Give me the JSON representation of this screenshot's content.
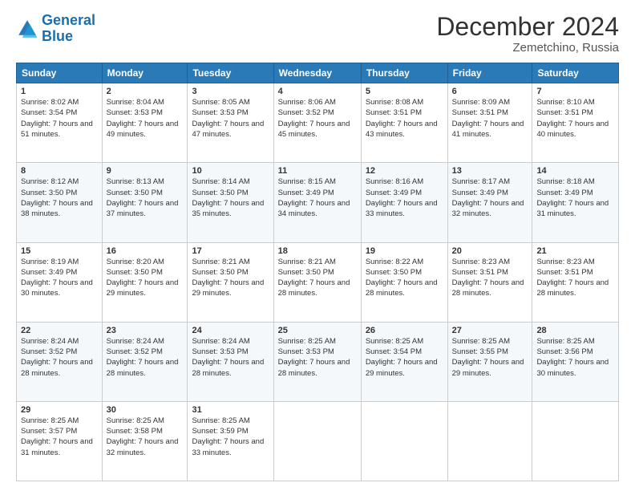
{
  "logo": {
    "line1": "General",
    "line2": "Blue"
  },
  "title": "December 2024",
  "subtitle": "Zemetchino, Russia",
  "days_of_week": [
    "Sunday",
    "Monday",
    "Tuesday",
    "Wednesday",
    "Thursday",
    "Friday",
    "Saturday"
  ],
  "weeks": [
    [
      {
        "day": "1",
        "sunrise": "Sunrise: 8:02 AM",
        "sunset": "Sunset: 3:54 PM",
        "daylight": "Daylight: 7 hours and 51 minutes."
      },
      {
        "day": "2",
        "sunrise": "Sunrise: 8:04 AM",
        "sunset": "Sunset: 3:53 PM",
        "daylight": "Daylight: 7 hours and 49 minutes."
      },
      {
        "day": "3",
        "sunrise": "Sunrise: 8:05 AM",
        "sunset": "Sunset: 3:53 PM",
        "daylight": "Daylight: 7 hours and 47 minutes."
      },
      {
        "day": "4",
        "sunrise": "Sunrise: 8:06 AM",
        "sunset": "Sunset: 3:52 PM",
        "daylight": "Daylight: 7 hours and 45 minutes."
      },
      {
        "day": "5",
        "sunrise": "Sunrise: 8:08 AM",
        "sunset": "Sunset: 3:51 PM",
        "daylight": "Daylight: 7 hours and 43 minutes."
      },
      {
        "day": "6",
        "sunrise": "Sunrise: 8:09 AM",
        "sunset": "Sunset: 3:51 PM",
        "daylight": "Daylight: 7 hours and 41 minutes."
      },
      {
        "day": "7",
        "sunrise": "Sunrise: 8:10 AM",
        "sunset": "Sunset: 3:51 PM",
        "daylight": "Daylight: 7 hours and 40 minutes."
      }
    ],
    [
      {
        "day": "8",
        "sunrise": "Sunrise: 8:12 AM",
        "sunset": "Sunset: 3:50 PM",
        "daylight": "Daylight: 7 hours and 38 minutes."
      },
      {
        "day": "9",
        "sunrise": "Sunrise: 8:13 AM",
        "sunset": "Sunset: 3:50 PM",
        "daylight": "Daylight: 7 hours and 37 minutes."
      },
      {
        "day": "10",
        "sunrise": "Sunrise: 8:14 AM",
        "sunset": "Sunset: 3:50 PM",
        "daylight": "Daylight: 7 hours and 35 minutes."
      },
      {
        "day": "11",
        "sunrise": "Sunrise: 8:15 AM",
        "sunset": "Sunset: 3:49 PM",
        "daylight": "Daylight: 7 hours and 34 minutes."
      },
      {
        "day": "12",
        "sunrise": "Sunrise: 8:16 AM",
        "sunset": "Sunset: 3:49 PM",
        "daylight": "Daylight: 7 hours and 33 minutes."
      },
      {
        "day": "13",
        "sunrise": "Sunrise: 8:17 AM",
        "sunset": "Sunset: 3:49 PM",
        "daylight": "Daylight: 7 hours and 32 minutes."
      },
      {
        "day": "14",
        "sunrise": "Sunrise: 8:18 AM",
        "sunset": "Sunset: 3:49 PM",
        "daylight": "Daylight: 7 hours and 31 minutes."
      }
    ],
    [
      {
        "day": "15",
        "sunrise": "Sunrise: 8:19 AM",
        "sunset": "Sunset: 3:49 PM",
        "daylight": "Daylight: 7 hours and 30 minutes."
      },
      {
        "day": "16",
        "sunrise": "Sunrise: 8:20 AM",
        "sunset": "Sunset: 3:50 PM",
        "daylight": "Daylight: 7 hours and 29 minutes."
      },
      {
        "day": "17",
        "sunrise": "Sunrise: 8:21 AM",
        "sunset": "Sunset: 3:50 PM",
        "daylight": "Daylight: 7 hours and 29 minutes."
      },
      {
        "day": "18",
        "sunrise": "Sunrise: 8:21 AM",
        "sunset": "Sunset: 3:50 PM",
        "daylight": "Daylight: 7 hours and 28 minutes."
      },
      {
        "day": "19",
        "sunrise": "Sunrise: 8:22 AM",
        "sunset": "Sunset: 3:50 PM",
        "daylight": "Daylight: 7 hours and 28 minutes."
      },
      {
        "day": "20",
        "sunrise": "Sunrise: 8:23 AM",
        "sunset": "Sunset: 3:51 PM",
        "daylight": "Daylight: 7 hours and 28 minutes."
      },
      {
        "day": "21",
        "sunrise": "Sunrise: 8:23 AM",
        "sunset": "Sunset: 3:51 PM",
        "daylight": "Daylight: 7 hours and 28 minutes."
      }
    ],
    [
      {
        "day": "22",
        "sunrise": "Sunrise: 8:24 AM",
        "sunset": "Sunset: 3:52 PM",
        "daylight": "Daylight: 7 hours and 28 minutes."
      },
      {
        "day": "23",
        "sunrise": "Sunrise: 8:24 AM",
        "sunset": "Sunset: 3:52 PM",
        "daylight": "Daylight: 7 hours and 28 minutes."
      },
      {
        "day": "24",
        "sunrise": "Sunrise: 8:24 AM",
        "sunset": "Sunset: 3:53 PM",
        "daylight": "Daylight: 7 hours and 28 minutes."
      },
      {
        "day": "25",
        "sunrise": "Sunrise: 8:25 AM",
        "sunset": "Sunset: 3:53 PM",
        "daylight": "Daylight: 7 hours and 28 minutes."
      },
      {
        "day": "26",
        "sunrise": "Sunrise: 8:25 AM",
        "sunset": "Sunset: 3:54 PM",
        "daylight": "Daylight: 7 hours and 29 minutes."
      },
      {
        "day": "27",
        "sunrise": "Sunrise: 8:25 AM",
        "sunset": "Sunset: 3:55 PM",
        "daylight": "Daylight: 7 hours and 29 minutes."
      },
      {
        "day": "28",
        "sunrise": "Sunrise: 8:25 AM",
        "sunset": "Sunset: 3:56 PM",
        "daylight": "Daylight: 7 hours and 30 minutes."
      }
    ],
    [
      {
        "day": "29",
        "sunrise": "Sunrise: 8:25 AM",
        "sunset": "Sunset: 3:57 PM",
        "daylight": "Daylight: 7 hours and 31 minutes."
      },
      {
        "day": "30",
        "sunrise": "Sunrise: 8:25 AM",
        "sunset": "Sunset: 3:58 PM",
        "daylight": "Daylight: 7 hours and 32 minutes."
      },
      {
        "day": "31",
        "sunrise": "Sunrise: 8:25 AM",
        "sunset": "Sunset: 3:59 PM",
        "daylight": "Daylight: 7 hours and 33 minutes."
      },
      null,
      null,
      null,
      null
    ]
  ]
}
